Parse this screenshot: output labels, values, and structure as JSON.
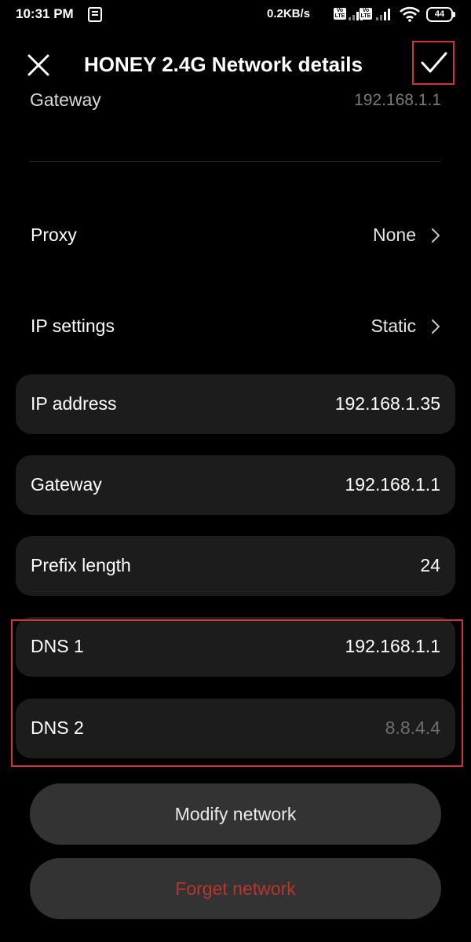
{
  "status_bar": {
    "time": "10:31 PM",
    "network_speed": "0.2KB/s",
    "volte_label": "Vo LTE",
    "battery": "44"
  },
  "header": {
    "title": "HONEY 2.4G Network details",
    "close_icon": "close-icon",
    "confirm_icon": "checkmark-icon"
  },
  "partial_row": {
    "label": "Gateway",
    "value": "192.168.1.1"
  },
  "settings": {
    "proxy": {
      "label": "Proxy",
      "value": "None"
    },
    "ip_settings": {
      "label": "IP settings",
      "value": "Static"
    }
  },
  "fields": {
    "ip_address": {
      "label": "IP address",
      "value": "192.168.1.35"
    },
    "gateway": {
      "label": "Gateway",
      "value": "192.168.1.1"
    },
    "prefix_length": {
      "label": "Prefix length",
      "value": "24"
    },
    "dns1": {
      "label": "DNS 1",
      "value": "192.168.1.1"
    },
    "dns2": {
      "label": "DNS 2",
      "placeholder": "8.8.4.4"
    }
  },
  "actions": {
    "modify": "Modify network",
    "forget": "Forget network"
  },
  "colors": {
    "background": "#000000",
    "card": "#1c1c1c",
    "button": "#333333",
    "highlight": "#d0333a",
    "danger_text": "#b8362c"
  }
}
